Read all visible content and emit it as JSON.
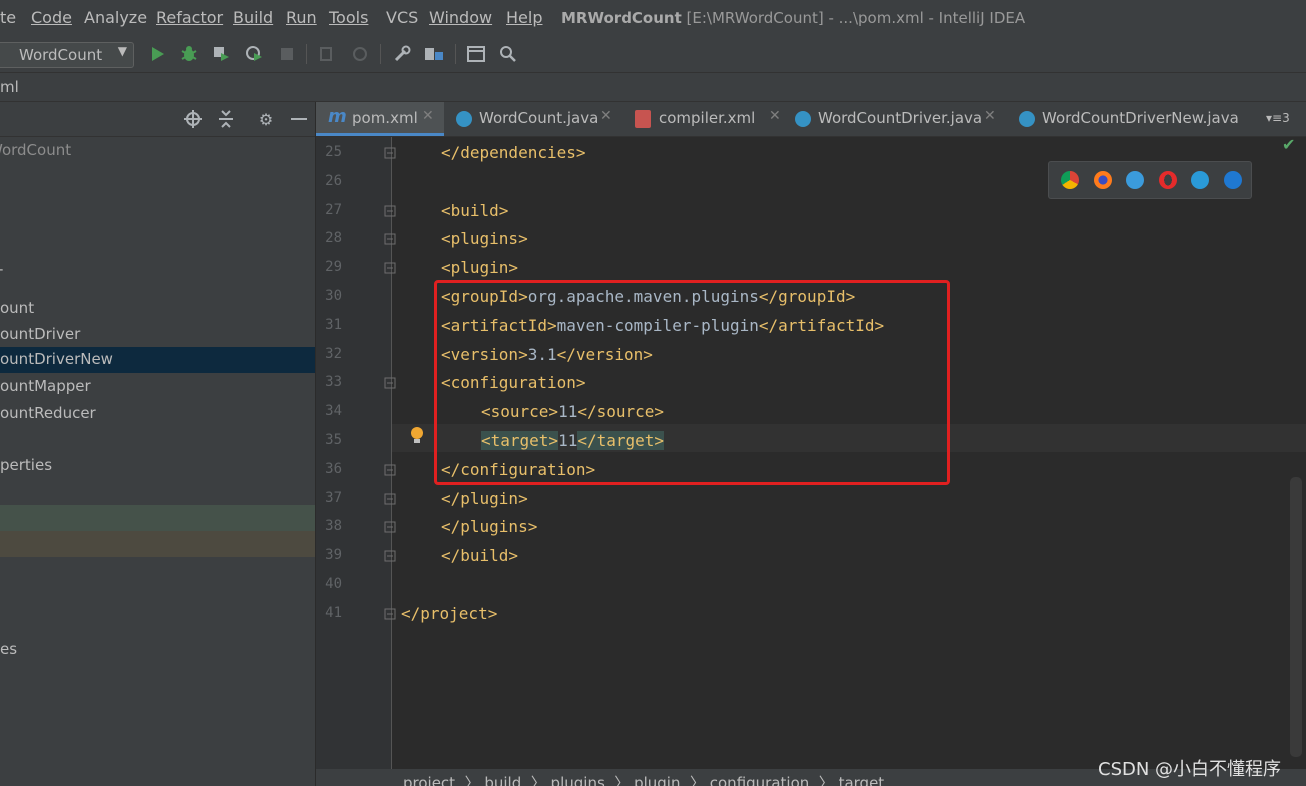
{
  "menubar": {
    "items": [
      "te",
      "Code",
      "Analyze",
      "Refactor",
      "Build",
      "Run",
      "Tools",
      "VCS",
      "Window",
      "Help"
    ],
    "title_bold": "MRWordCount",
    "title_rest": " [E:\\MRWordCount] - ...\\pom.xml - IntelliJ IDEA"
  },
  "toolbar": {
    "run_config": "WordCount",
    "icons": [
      "run-icon",
      "debug-icon",
      "coverage-icon",
      "profile-icon",
      "stop-icon",
      "build-icon",
      "build-project-icon",
      "settings-wrench-icon",
      "project-structure-icon",
      "terminal-icon",
      "search-icon"
    ]
  },
  "navbar": {
    "crumb": "ml"
  },
  "project_panel": {
    "header_icons": [
      "locate-icon",
      "collapse-icon",
      "gear-icon",
      "minimize-icon"
    ],
    "items": [
      {
        "label": "WordCount"
      },
      {
        "label": "ount"
      },
      {
        "label": "ountDriver"
      },
      {
        "label": "ountDriverNew"
      },
      {
        "label": "ountMapper"
      },
      {
        "label": "ountReducer"
      },
      {
        "label": "perties"
      },
      {
        "label": "es"
      }
    ]
  },
  "tabs": [
    {
      "label": "pom.xml",
      "icon": "maven-icon",
      "active": true
    },
    {
      "label": "WordCount.java",
      "icon": "java-class-icon",
      "active": false
    },
    {
      "label": "compiler.xml",
      "icon": "xml-file-icon",
      "active": false
    },
    {
      "label": "WordCountDriver.java",
      "icon": "java-class-icon",
      "active": false
    },
    {
      "label": "WordCountDriverNew.java",
      "icon": "java-class-icon",
      "active": false
    }
  ],
  "tabs_overflow": "3",
  "editor": {
    "lines": [
      {
        "n": "25",
        "code": "</dependencies>",
        "kind": "tag"
      },
      {
        "n": "26",
        "code": "",
        "kind": "tag"
      },
      {
        "n": "27",
        "code": "<build>",
        "kind": "tag"
      },
      {
        "n": "28",
        "code": "<plugins>",
        "kind": "tag"
      },
      {
        "n": "29",
        "code": "<plugin>",
        "kind": "tag"
      },
      {
        "n": "30",
        "open": "<groupId>",
        "value": "org.apache.maven.plugins",
        "close": "</groupId>"
      },
      {
        "n": "31",
        "open": "<artifactId>",
        "value": "maven-compiler-plugin",
        "close": "</artifactId>"
      },
      {
        "n": "32",
        "open": "<version>",
        "value": "3.1",
        "close": "</version>"
      },
      {
        "n": "33",
        "code": "<configuration>",
        "kind": "tag"
      },
      {
        "n": "34",
        "open": "<source>",
        "value": "11",
        "close": "</source>"
      },
      {
        "n": "35",
        "open": "<target>",
        "value": "11",
        "close": "</target>"
      },
      {
        "n": "36",
        "code": "</configuration>",
        "kind": "tag"
      },
      {
        "n": "37",
        "code": "</plugin>",
        "kind": "tag"
      },
      {
        "n": "38",
        "code": "</plugins>",
        "kind": "tag"
      },
      {
        "n": "39",
        "code": "</build>",
        "kind": "tag"
      },
      {
        "n": "40",
        "code": "",
        "kind": "tag"
      },
      {
        "n": "41",
        "code": "</project>",
        "kind": "tag"
      }
    ],
    "browser_icons": [
      "chrome-icon",
      "firefox-icon",
      "safari-icon",
      "opera-icon",
      "ie-icon",
      "edge-icon"
    ]
  },
  "breadcrumbs": "project  〉 build  〉 plugins  〉 plugin  〉 configuration  〉 target",
  "watermark": "CSDN @小白不懂程序",
  "colors": {
    "accent": "#4a88c7",
    "tag": "#e8bf6a",
    "value": "#a9b7c6",
    "highlight_box": "#e02020",
    "selection": "#0d293e"
  }
}
